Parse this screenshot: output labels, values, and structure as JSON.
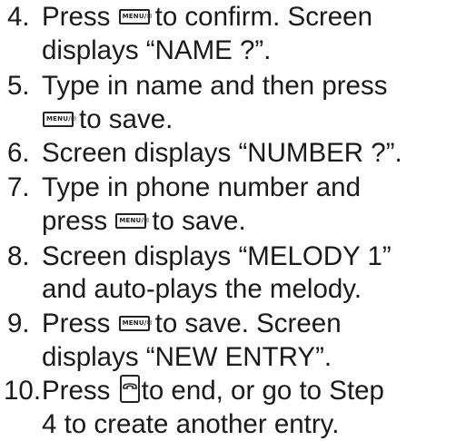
{
  "keys": {
    "menu_key_label": "MENU/✉"
  },
  "steps": [
    {
      "number": "4.",
      "lines": [
        "Press",
        "to confirm.  Screen",
        "displays “NAME ?”."
      ]
    },
    {
      "number": "5.",
      "lines": [
        "Type in name and then press",
        "to save."
      ]
    },
    {
      "number": "6.",
      "lines": [
        "Screen displays “NUMBER ?”."
      ]
    },
    {
      "number": "7.",
      "lines": [
        "Type in phone number and",
        "press",
        "to save."
      ]
    },
    {
      "number": "8.",
      "lines": [
        "Screen displays “MELODY 1”",
        "and auto-plays the melody."
      ]
    },
    {
      "number": "9.",
      "lines": [
        "Press",
        "to save.  Screen",
        "displays “NEW ENTRY”."
      ]
    },
    {
      "number": "10.",
      "lines": [
        "Press",
        "to end, or go to Step",
        "4 to create another entry."
      ]
    }
  ]
}
